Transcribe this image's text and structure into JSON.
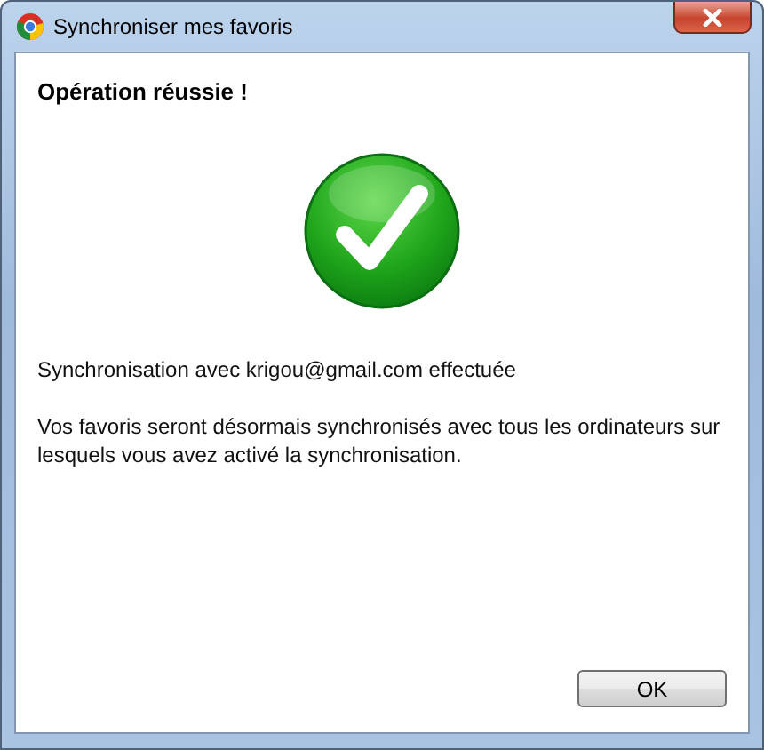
{
  "window": {
    "title": "Synchroniser mes favoris"
  },
  "heading": "Opération réussie !",
  "message": "Synchronisation avec krigou@gmail.com effectuée",
  "details": "Vos favoris seront désormais synchronisés avec tous les ordinateurs sur lesquels vous avez activé la synchronisation.",
  "buttons": [
    "OK"
  ]
}
